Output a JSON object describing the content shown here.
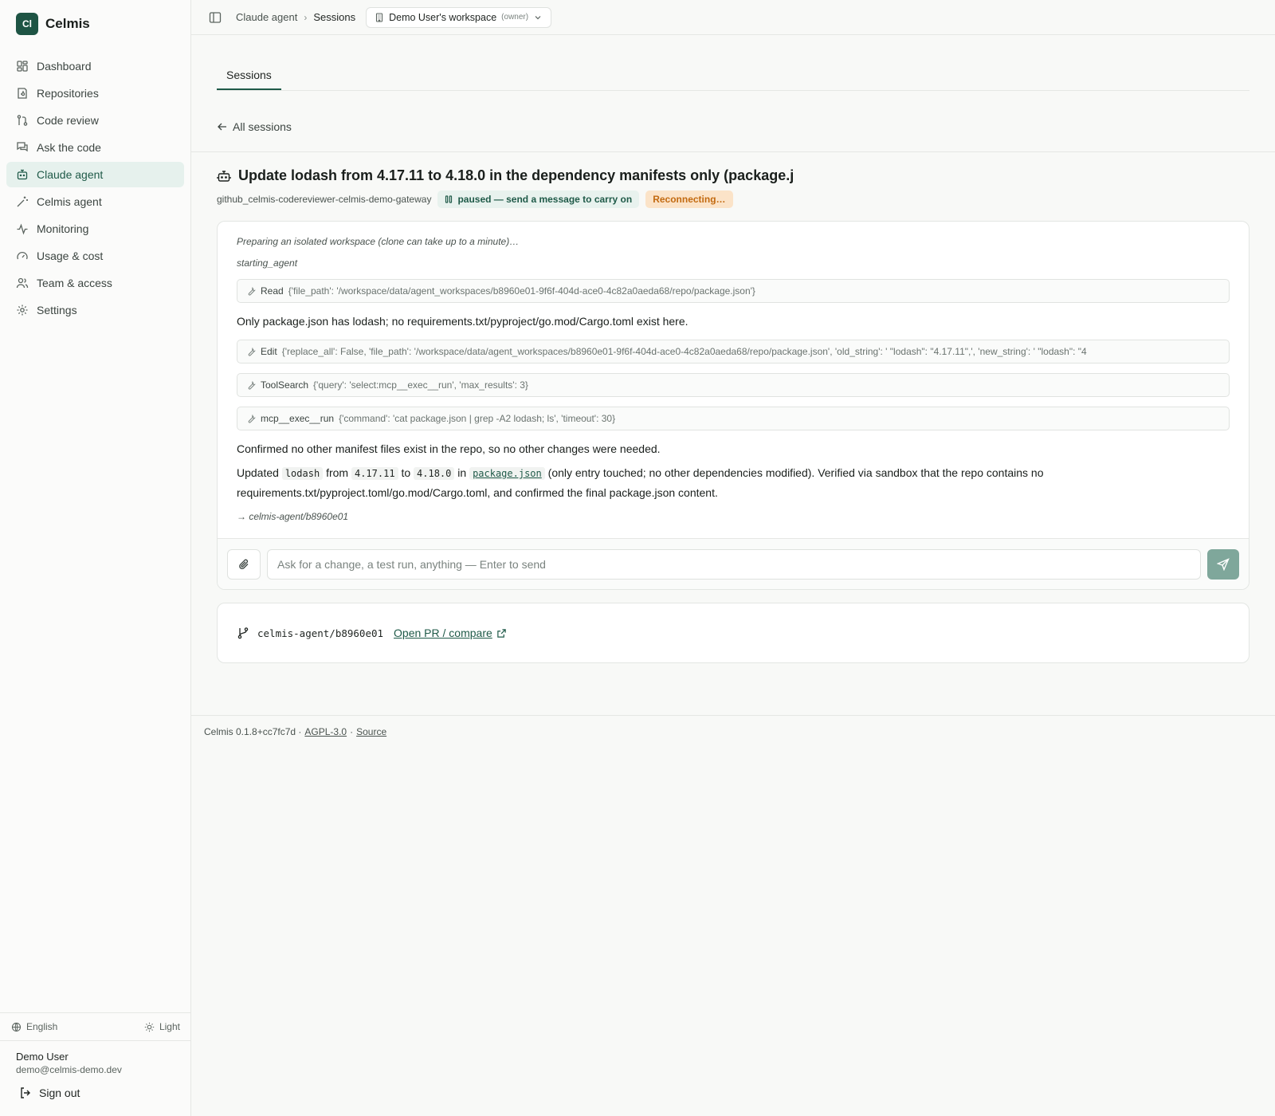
{
  "brand": {
    "logo": "Cl",
    "name": "Celmis"
  },
  "sidebar": {
    "items": [
      {
        "label": "Dashboard",
        "icon": "dashboard-icon"
      },
      {
        "label": "Repositories",
        "icon": "repositories-icon"
      },
      {
        "label": "Code review",
        "icon": "code-review-icon"
      },
      {
        "label": "Ask the code",
        "icon": "chat-icon"
      },
      {
        "label": "Claude agent",
        "icon": "bot-icon",
        "active": true
      },
      {
        "label": "Celmis agent",
        "icon": "wand-icon"
      },
      {
        "label": "Monitoring",
        "icon": "activity-icon"
      },
      {
        "label": "Usage & cost",
        "icon": "gauge-icon"
      },
      {
        "label": "Team & access",
        "icon": "users-icon"
      },
      {
        "label": "Settings",
        "icon": "gear-icon"
      }
    ],
    "language": "English",
    "theme": "Light",
    "user_name": "Demo User",
    "user_email": "demo@celmis-demo.dev",
    "sign_out": "Sign out"
  },
  "topbar": {
    "crumb_parent": "Claude agent",
    "crumb_current": "Sessions",
    "workspace": "Demo User's workspace",
    "workspace_role": "(owner)"
  },
  "main": {
    "tab": "Sessions",
    "back_label": "All sessions",
    "title": "Update lodash from 4.17.11 to 4.18.0 in the dependency manifests only (package.j",
    "repo": "github_celmis-codereviewer-celmis-demo-gateway",
    "status": "paused — send a message to carry on",
    "connection": "Reconnecting…"
  },
  "log": {
    "preparing": "Preparing an isolated workspace (clone can take up to a minute)…",
    "starting": "starting_agent",
    "tool1_name": "Read",
    "tool1_args": "{'file_path': '/workspace/data/agent_workspaces/b8960e01-9f6f-404d-ace0-4c82a0aeda68/repo/package.json'}",
    "msg1": "Only package.json has lodash; no requirements.txt/pyproject/go.mod/Cargo.toml exist here.",
    "tool2_name": "Edit",
    "tool2_args": "{'replace_all': False, 'file_path': '/workspace/data/agent_workspaces/b8960e01-9f6f-404d-ace0-4c82a0aeda68/repo/package.json', 'old_string': ' \"lodash\": \"4.17.11\",', 'new_string': ' \"lodash\": \"4",
    "tool3_name": "ToolSearch",
    "tool3_args": "{'query': 'select:mcp__exec__run', 'max_results': 3}",
    "tool4_name": "mcp__exec__run",
    "tool4_args": "{'command': 'cat package.json | grep -A2 lodash; ls', 'timeout': 30}",
    "msg2": "Confirmed no other manifest files exist in the repo, so no other changes were needed.",
    "msg3_a": "Updated",
    "msg3_code1": "lodash",
    "msg3_b": "from",
    "msg3_code2": "4.17.11",
    "msg3_c": "to",
    "msg3_code3": "4.18.0",
    "msg3_d": "in",
    "msg3_code4": "package.json",
    "msg3_e": "(only entry touched; no other dependencies modified). Verified via sandbox that the repo contains no requirements.txt/pyproject.toml/go.mod/Cargo.toml, and confirmed the final package.json content.",
    "branch_note": "→ celmis-agent/b8960e01"
  },
  "composer": {
    "placeholder": "Ask for a change, a test run, anything — Enter to send"
  },
  "branch": {
    "name": "celmis-agent/b8960e01",
    "pr_link": "Open PR / compare"
  },
  "footer": {
    "version": "Celmis 0.1.8+cc7fc7d ·",
    "license": "AGPL-3.0",
    "sep": "·",
    "source": "Source"
  }
}
